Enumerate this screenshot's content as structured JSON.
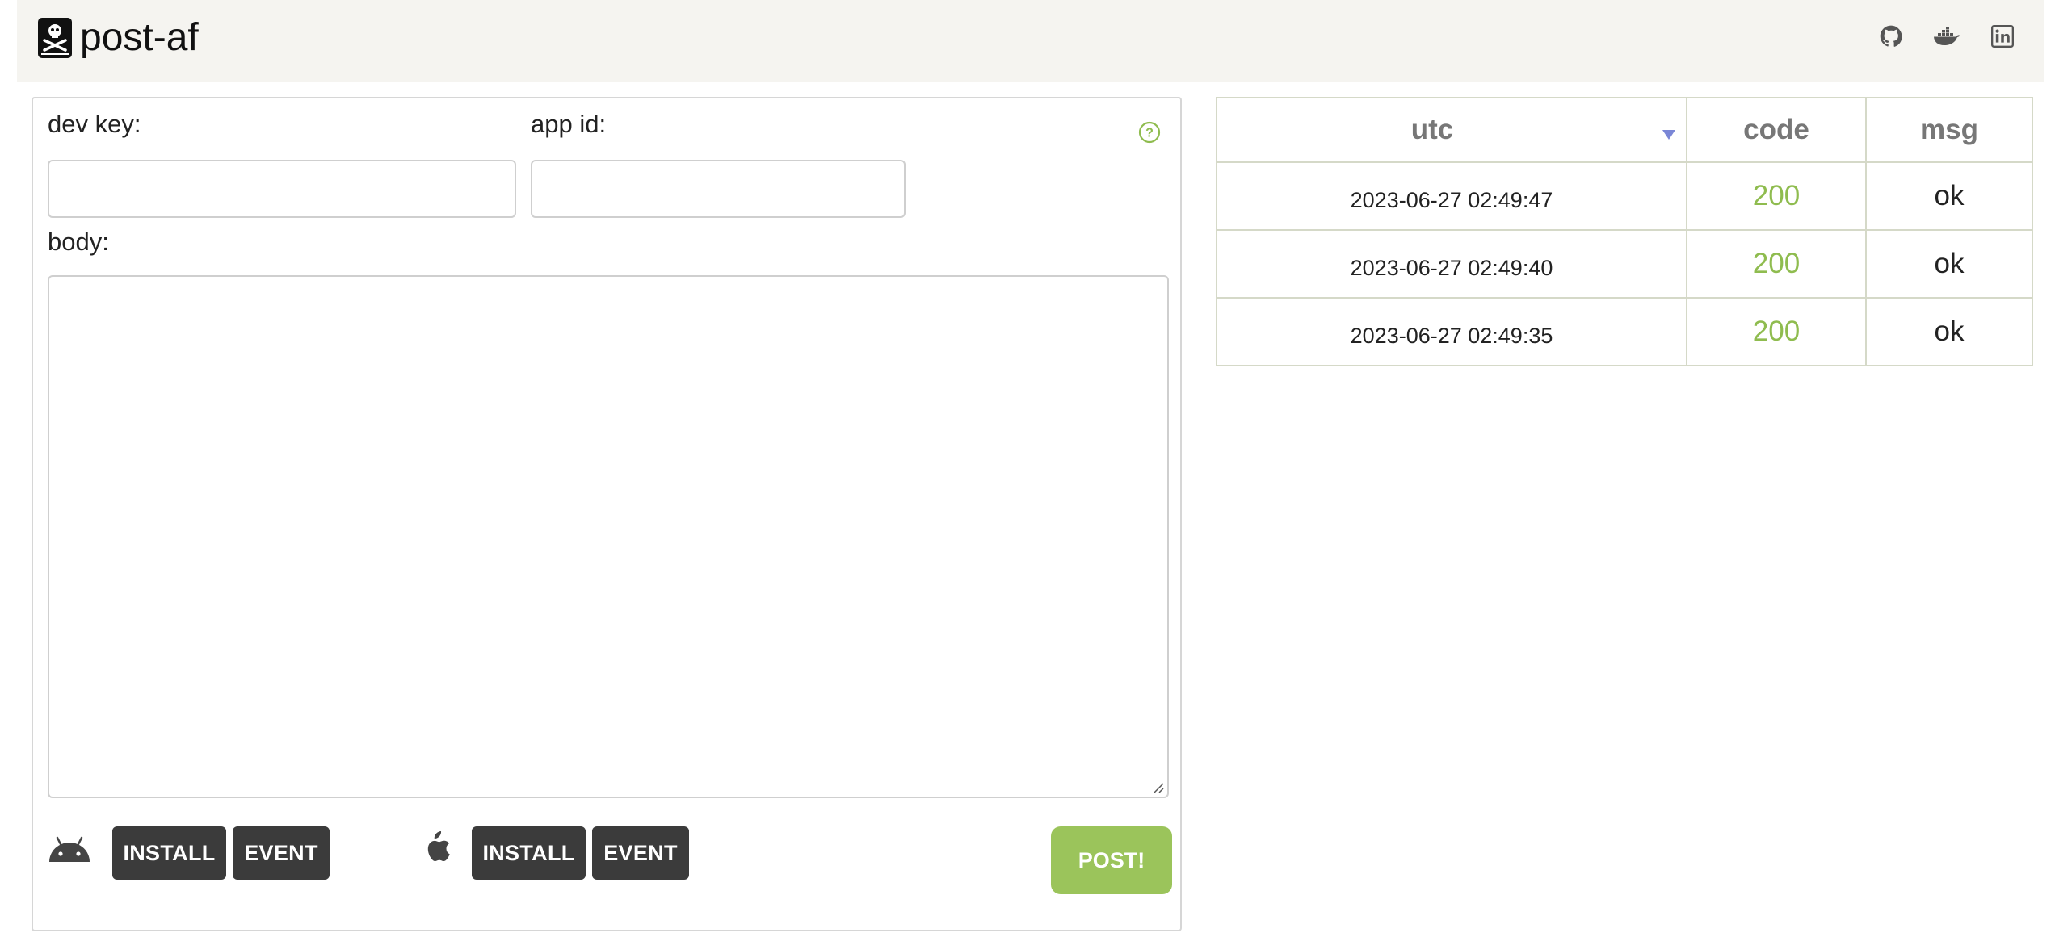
{
  "header": {
    "title": "post-af",
    "icons": [
      "github-icon",
      "docker-icon",
      "linkedin-icon"
    ]
  },
  "form": {
    "dev_key_label": "dev key:",
    "app_id_label": "app id:",
    "body_label": "body:",
    "dev_key_value": "",
    "app_id_value": "",
    "body_value": "",
    "android": {
      "icon": "android-icon",
      "install_label": "INSTALL",
      "event_label": "EVENT"
    },
    "ios": {
      "icon": "apple-icon",
      "install_label": "INSTALL",
      "event_label": "EVENT"
    },
    "post_label": "POST!",
    "help_icon": "question-circle-icon"
  },
  "log": {
    "columns": [
      "utc",
      "code",
      "msg"
    ],
    "sort_indicator": "sort-desc-icon",
    "rows": [
      {
        "utc": "2023-06-27 02:49:47",
        "code": "200",
        "msg": "ok"
      },
      {
        "utc": "2023-06-27 02:49:40",
        "code": "200",
        "msg": "ok"
      },
      {
        "utc": "2023-06-27 02:49:35",
        "code": "200",
        "msg": "ok"
      }
    ]
  },
  "colors": {
    "accent_green": "#9bc45b",
    "code_green": "#8fbc4f",
    "dark_button": "#3b3b3b",
    "header_bg": "#f5f4f0",
    "sort_blue": "#7a86d6"
  }
}
